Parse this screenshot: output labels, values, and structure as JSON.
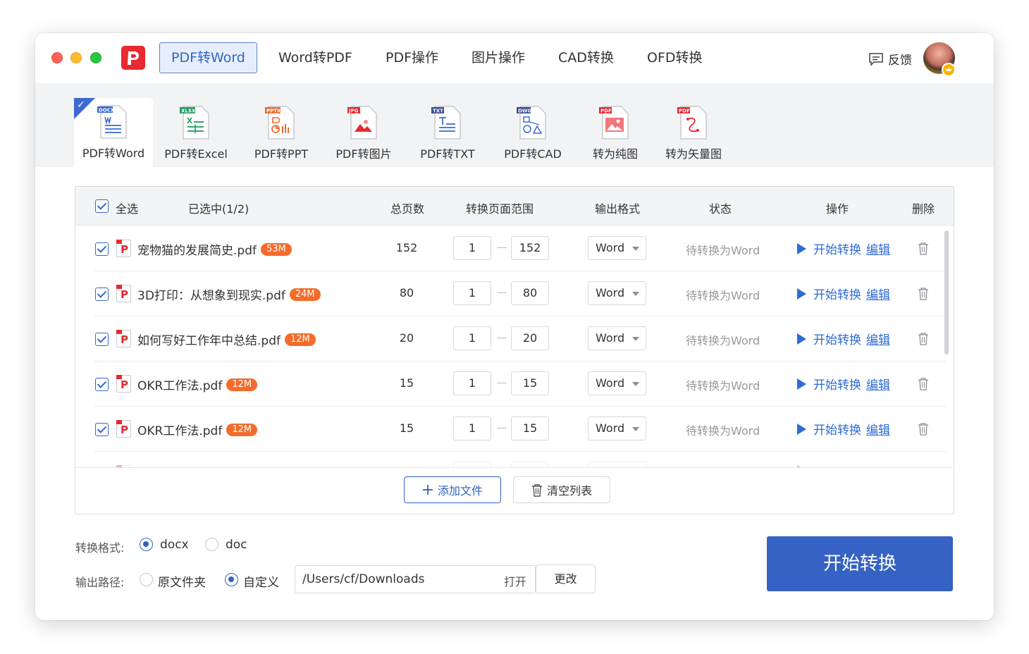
{
  "titlebar": {
    "tabs": [
      {
        "label": "PDF转Word",
        "active": true
      },
      {
        "label": "Word转PDF"
      },
      {
        "label": "PDF操作"
      },
      {
        "label": "图片操作"
      },
      {
        "label": "CAD转换"
      },
      {
        "label": "OFD转换"
      }
    ],
    "feedback_label": "反馈",
    "feedback_icon": "message-icon",
    "avatar_badge_icon": "vip-badge-icon"
  },
  "tools": [
    {
      "label": "PDF转Word",
      "tag": "DOCX",
      "color": "#3a6ad4",
      "active": true
    },
    {
      "label": "PDF转Excel",
      "tag": "XLSX",
      "color": "#1d9a5c"
    },
    {
      "label": "PDF转PPT",
      "tag": "PPTX",
      "color": "#f06a35"
    },
    {
      "label": "PDF转图片",
      "tag": "JPG",
      "color": "#e8292f"
    },
    {
      "label": "PDF转TXT",
      "tag": "TXT",
      "color": "#3a4e8c"
    },
    {
      "label": "PDF转CAD",
      "tag": "DWG",
      "color": "#3a4e8c"
    },
    {
      "label": "转为纯图",
      "tag": "PDF",
      "color": "#e8292f"
    },
    {
      "label": "转为矢量图",
      "tag": "PDF",
      "color": "#e8292f"
    }
  ],
  "table": {
    "select_all_label": "全选",
    "selected_count": "已选中(1/2)",
    "columns": [
      "总页数",
      "转换页面范围",
      "输出格式",
      "状态",
      "操作",
      "删除"
    ],
    "rows": [
      {
        "name": "宠物猫的发展简史.pdf",
        "size": "53M",
        "pages": "152",
        "from": "1",
        "to": "152",
        "format": "Word",
        "status": "待转换为Word",
        "action": "开始转换",
        "edit": "编辑"
      },
      {
        "name": "3D打印：从想象到现实.pdf",
        "size": "24M",
        "pages": "80",
        "from": "1",
        "to": "80",
        "format": "Word",
        "status": "待转换为Word",
        "action": "开始转换",
        "edit": "编辑"
      },
      {
        "name": "如何写好工作年中总结.pdf",
        "size": "12M",
        "pages": "20",
        "from": "1",
        "to": "20",
        "format": "Word",
        "status": "待转换为Word",
        "action": "开始转换",
        "edit": "编辑"
      },
      {
        "name": "OKR工作法.pdf",
        "size": "12M",
        "pages": "15",
        "from": "1",
        "to": "15",
        "format": "Word",
        "status": "待转换为Word",
        "action": "开始转换",
        "edit": "编辑"
      },
      {
        "name": "OKR工作法.pdf",
        "size": "12M",
        "pages": "15",
        "from": "1",
        "to": "15",
        "format": "Word",
        "status": "待转换为Word",
        "action": "开始转换",
        "edit": "编辑"
      },
      {
        "name": "",
        "size": "",
        "pages": "",
        "from": "",
        "to": "",
        "format": "",
        "status": "",
        "action": "",
        "edit": ""
      }
    ],
    "add_files_label": "添加文件",
    "clear_list_label": "清空列表"
  },
  "settings": {
    "format_label": "转换格式:",
    "format_options": [
      {
        "label": "docx",
        "selected": true
      },
      {
        "label": "doc",
        "selected": false
      }
    ],
    "output_label": "输出路径:",
    "output_options": [
      {
        "label": "原文件夹",
        "selected": false
      },
      {
        "label": "自定义",
        "selected": true
      }
    ],
    "path_value": "/Users/cf/Downloads",
    "open_label": "打开",
    "change_label": "更改",
    "start_label": "开始转换"
  },
  "colors": {
    "accent": "#3562c4",
    "link": "#2e6bd6",
    "size_badge": "#f46b2b",
    "pdf_red": "#e8292f"
  }
}
